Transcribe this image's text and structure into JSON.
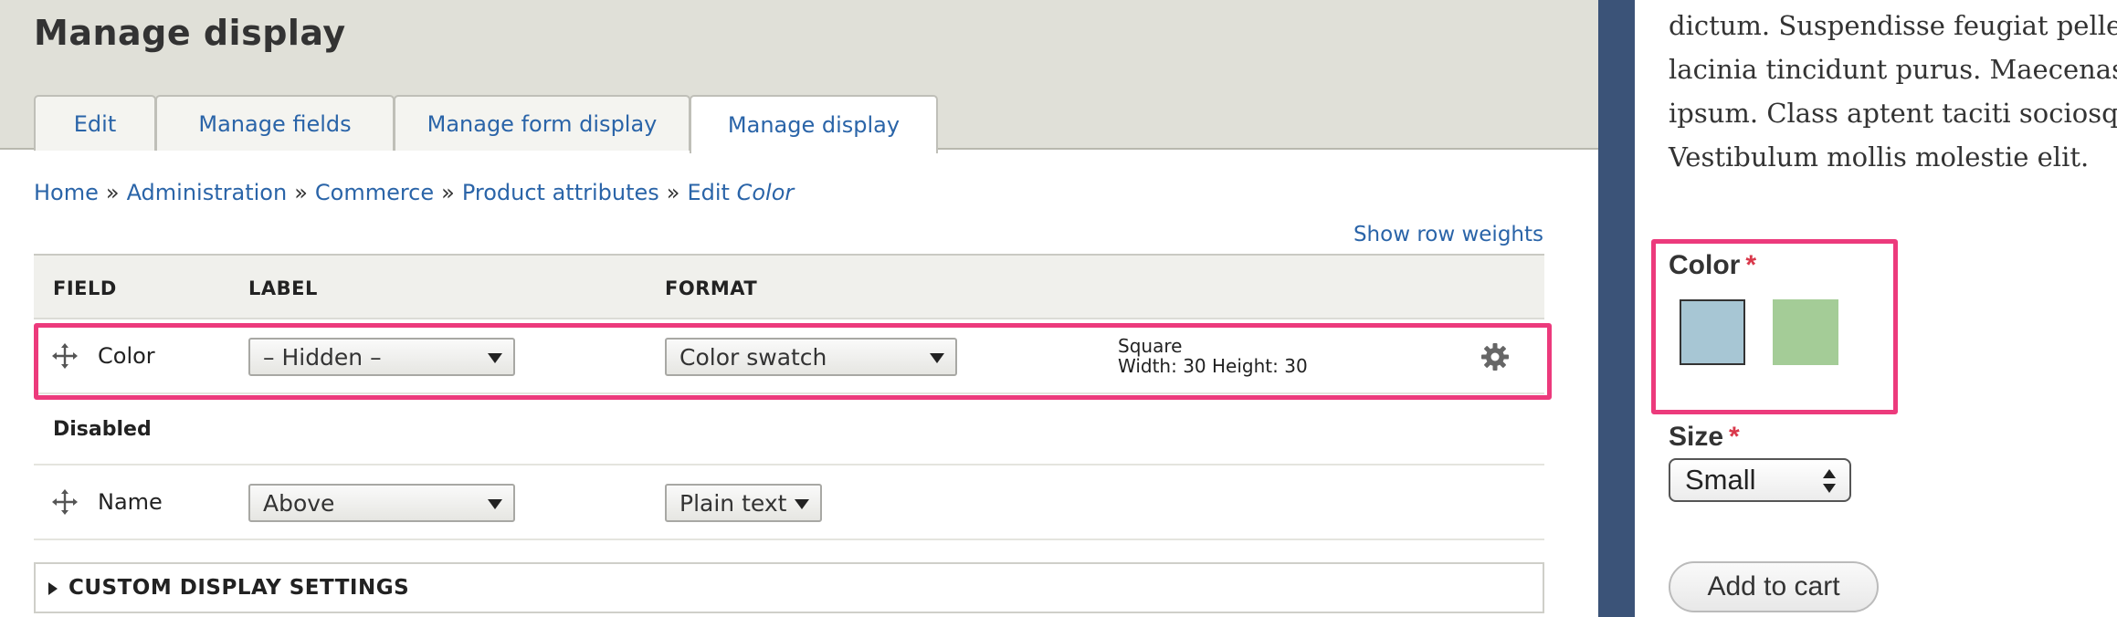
{
  "header": {
    "title": "Manage display",
    "tabs": [
      {
        "label": "Edit",
        "active": false
      },
      {
        "label": "Manage fields",
        "active": false
      },
      {
        "label": "Manage form display",
        "active": false
      },
      {
        "label": "Manage display",
        "active": true
      }
    ]
  },
  "breadcrumb": {
    "items": [
      "Home",
      "Administration",
      "Commerce",
      "Product attributes"
    ],
    "separator": "»",
    "current_prefix": "Edit",
    "current_name": "Color"
  },
  "show_row_weights": "Show row weights",
  "table": {
    "columns": [
      "FIELD",
      "LABEL",
      "FORMAT"
    ],
    "rows": [
      {
        "field": "Color",
        "label": "– Hidden –",
        "format": "Color swatch",
        "summary_line1": "Square",
        "summary_line2": "Width: 30 Height: 30",
        "highlighted": true
      }
    ],
    "disabled_section": "Disabled",
    "disabled_rows": [
      {
        "field": "Name",
        "label": "Above",
        "format": "Plain text"
      }
    ]
  },
  "custom_display_settings": "CUSTOM DISPLAY SETTINGS",
  "preview": {
    "lorem_lines": [
      "dictum. Suspendisse feugiat pellentesque",
      "lacinia tincidunt purus. Maecenas eget",
      "ipsum. Class aptent taciti sociosqu ad",
      "Vestibulum mollis molestie elit."
    ],
    "color_label": "Color",
    "required_mark": "*",
    "swatches": [
      {
        "name": "blue",
        "color": "#a7c6d4",
        "selected": true
      },
      {
        "name": "green",
        "color": "#a4cc97",
        "selected": false
      }
    ],
    "size_label": "Size",
    "size_value": "Small",
    "add_to_cart": "Add to cart"
  },
  "colors": {
    "highlight": "#ec3a7c",
    "link": "#2a64a8",
    "sidebar": "#3b5378",
    "required": "#d9384b"
  }
}
